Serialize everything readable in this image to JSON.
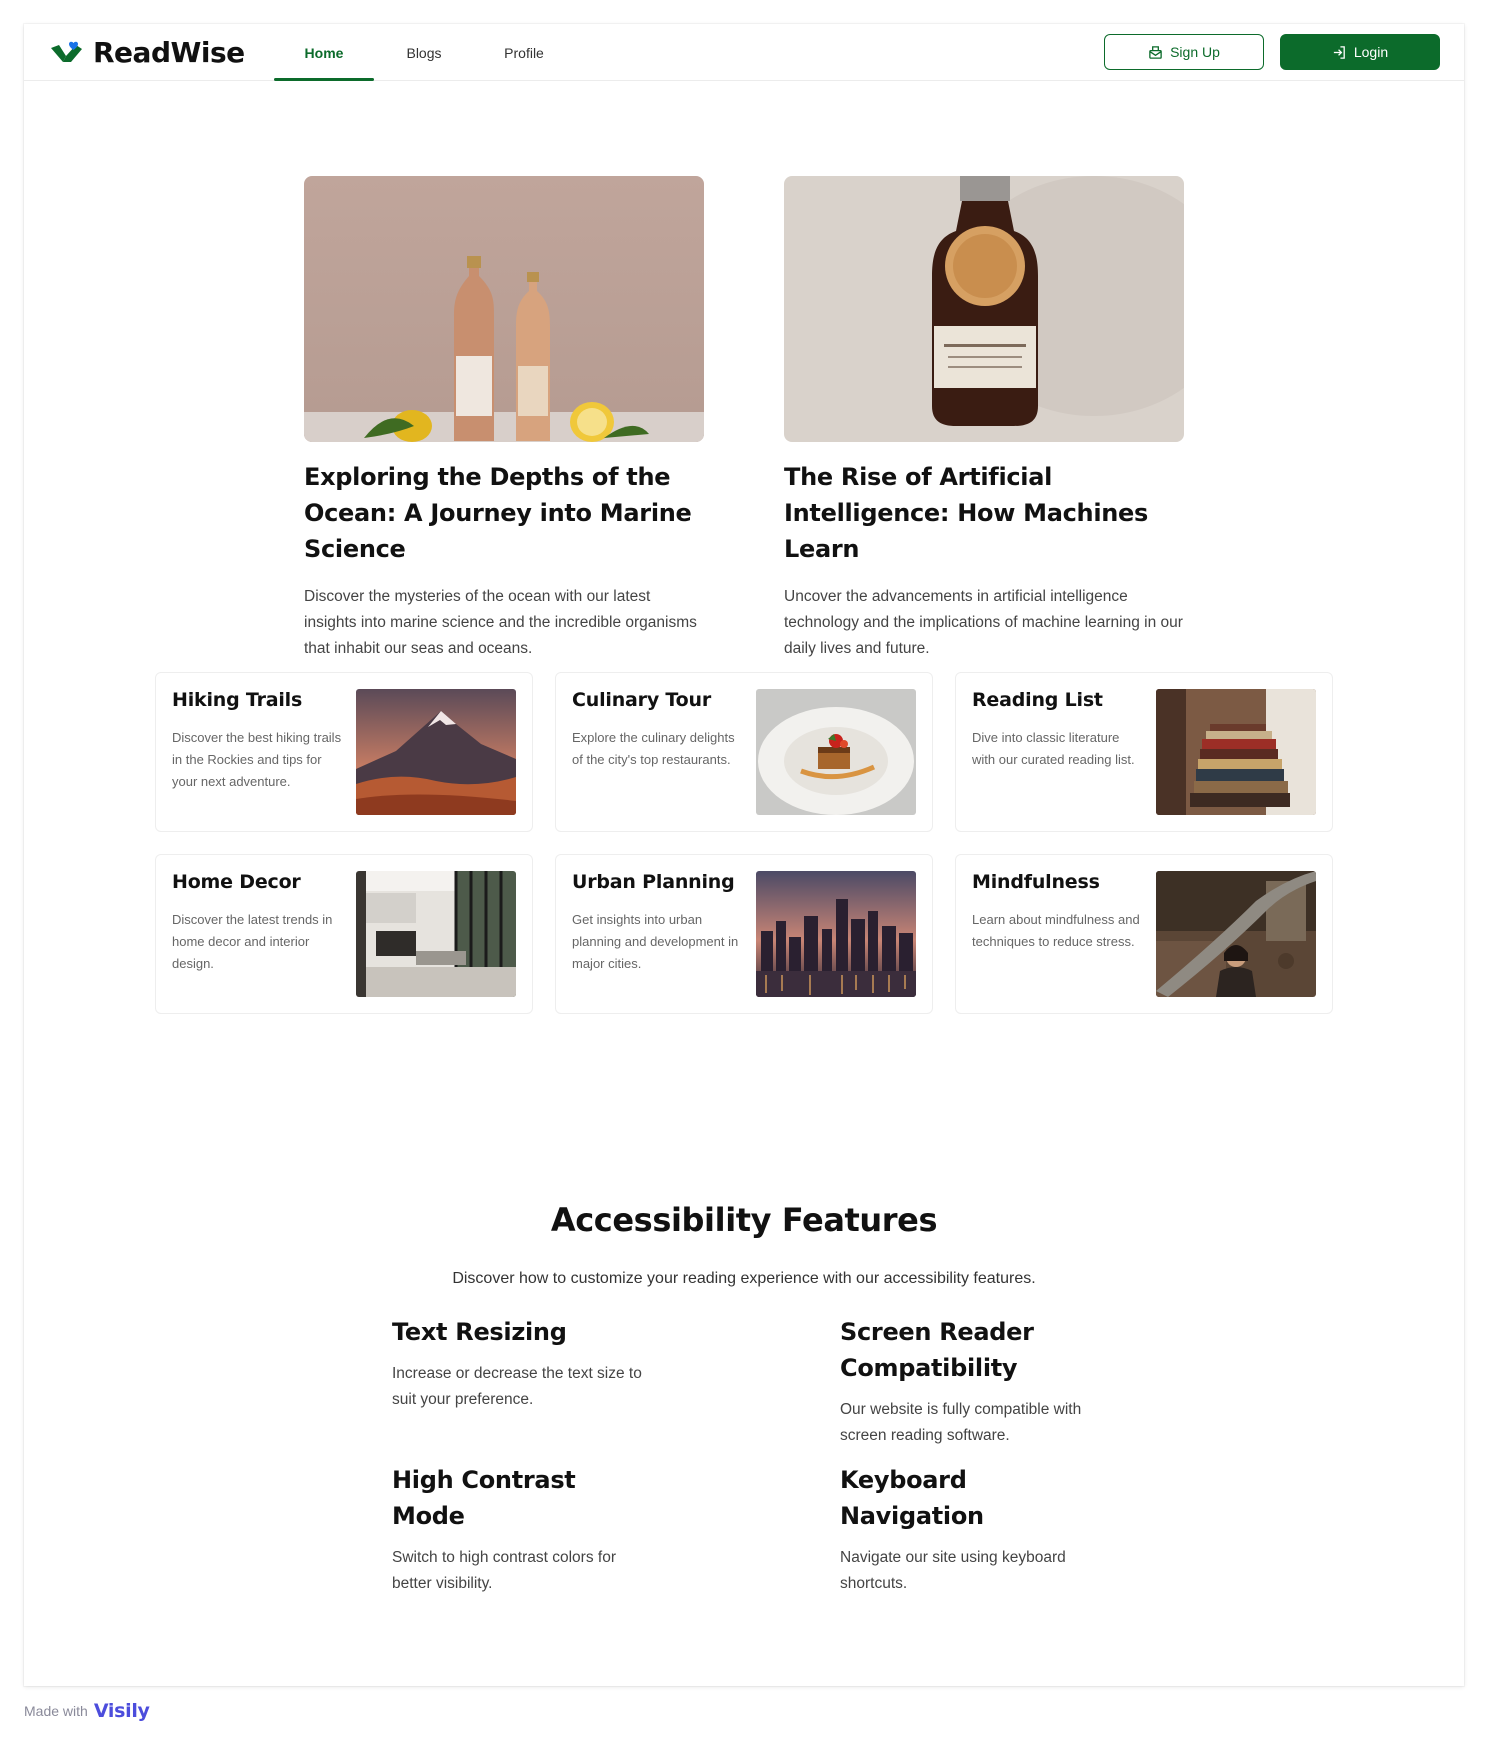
{
  "header": {
    "brand": "ReadWise",
    "nav": [
      {
        "label": "Home",
        "active": true
      },
      {
        "label": "Blogs",
        "active": false
      },
      {
        "label": "Profile",
        "active": false
      }
    ],
    "signup_label": "Sign Up",
    "login_label": "Login"
  },
  "featured": [
    {
      "title": "Exploring the Depths of the Ocean: A Journey into Marine Science",
      "description": "Discover the mysteries of the ocean with our latest insights into marine science and the incredible organisms that inhabit our seas and oceans."
    },
    {
      "title": "The Rise of Artificial Intelligence: How Machines Learn",
      "description": "Uncover the advancements in artificial intelligence technology and the implications of machine learning in our daily lives and future."
    }
  ],
  "cards": [
    {
      "title": "Hiking Trails",
      "description": "Discover the best hiking trails in the Rockies and tips for your next adventure."
    },
    {
      "title": "Culinary Tour",
      "description": "Explore the culinary delights of the city's top restaurants."
    },
    {
      "title": "Reading List",
      "description": "Dive into classic literature with our curated reading list."
    },
    {
      "title": "Home Decor",
      "description": "Discover the latest trends in home decor and interior design."
    },
    {
      "title": "Urban Planning",
      "description": "Get insights into urban planning and development in major cities."
    },
    {
      "title": "Mindfulness",
      "description": "Learn about mindfulness and techniques to reduce stress."
    }
  ],
  "accessibility": {
    "title": "Accessibility Features",
    "subtitle": "Discover how to customize your reading experience with our accessibility features.",
    "features": [
      {
        "title": "Text Resizing",
        "description": "Increase or decrease the text size to suit your preference."
      },
      {
        "title": "Screen Reader Compatibility",
        "description": "Our website is fully compatible with screen reading software."
      },
      {
        "title": "High Contrast Mode",
        "description": "Switch to high contrast colors for better visibility."
      },
      {
        "title": "Keyboard Navigation",
        "description": "Navigate our site using keyboard shortcuts."
      }
    ]
  },
  "footer": {
    "made_with": "Made with",
    "brand": "Visily"
  },
  "colors": {
    "primary": "#0c6b2b",
    "logo_accent": "#1a73e8",
    "visily": "#4c4ddc"
  },
  "icons": [
    "readwise-logo-icon",
    "signup-mail-icon",
    "login-arrow-icon"
  ]
}
